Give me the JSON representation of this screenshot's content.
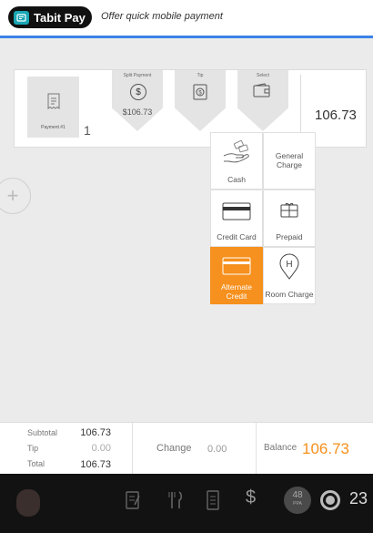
{
  "app": {
    "name": "Tabit Pay",
    "tagline": "Offer quick mobile payment"
  },
  "payment_panel": {
    "payment_label": "Payment #1",
    "payment_count": "1",
    "steps": [
      {
        "title": "Split Payment",
        "icon": "dollar-circle-icon",
        "amount": "$106.73"
      },
      {
        "title": "Tip",
        "icon": "tip-icon"
      },
      {
        "title": "Select",
        "icon": "wallet-icon"
      }
    ],
    "total": "106.73"
  },
  "payment_methods": [
    {
      "label": "Cash",
      "icon": "cash-hand-icon"
    },
    {
      "label": "General Charge",
      "icon": "none"
    },
    {
      "label": "Credit Card",
      "icon": "credit-card-icon"
    },
    {
      "label": "Prepaid",
      "icon": "gift-card-icon"
    },
    {
      "label": "Alternate Credit",
      "icon": "alternate-card-icon",
      "selected": true
    },
    {
      "label": "Room Charge",
      "icon": "hotel-pin-icon"
    }
  ],
  "summary": {
    "subtotal_label": "Subtotal",
    "subtotal_value": "106.73",
    "tip_label": "Tip",
    "tip_value": "0.00",
    "total_label": "Total",
    "total_value": "106.73",
    "change_label": "Change",
    "change_value": "0.00",
    "balance_label": "Balance",
    "balance_value": "106.73"
  },
  "dock": {
    "ppa_value": "48",
    "ppa_label": "PPA",
    "count": "23",
    "icons": [
      "avatar",
      "notes-icon",
      "fork-knife-icon",
      "receipt-icon",
      "dollar-icon",
      "ppa-badge",
      "circle-icon"
    ]
  },
  "colors": {
    "accent_blue": "#3b82e6",
    "selected_orange": "#f6901e",
    "balance_orange": "#f6901e",
    "tabit_teal": "#1aa6b5"
  }
}
